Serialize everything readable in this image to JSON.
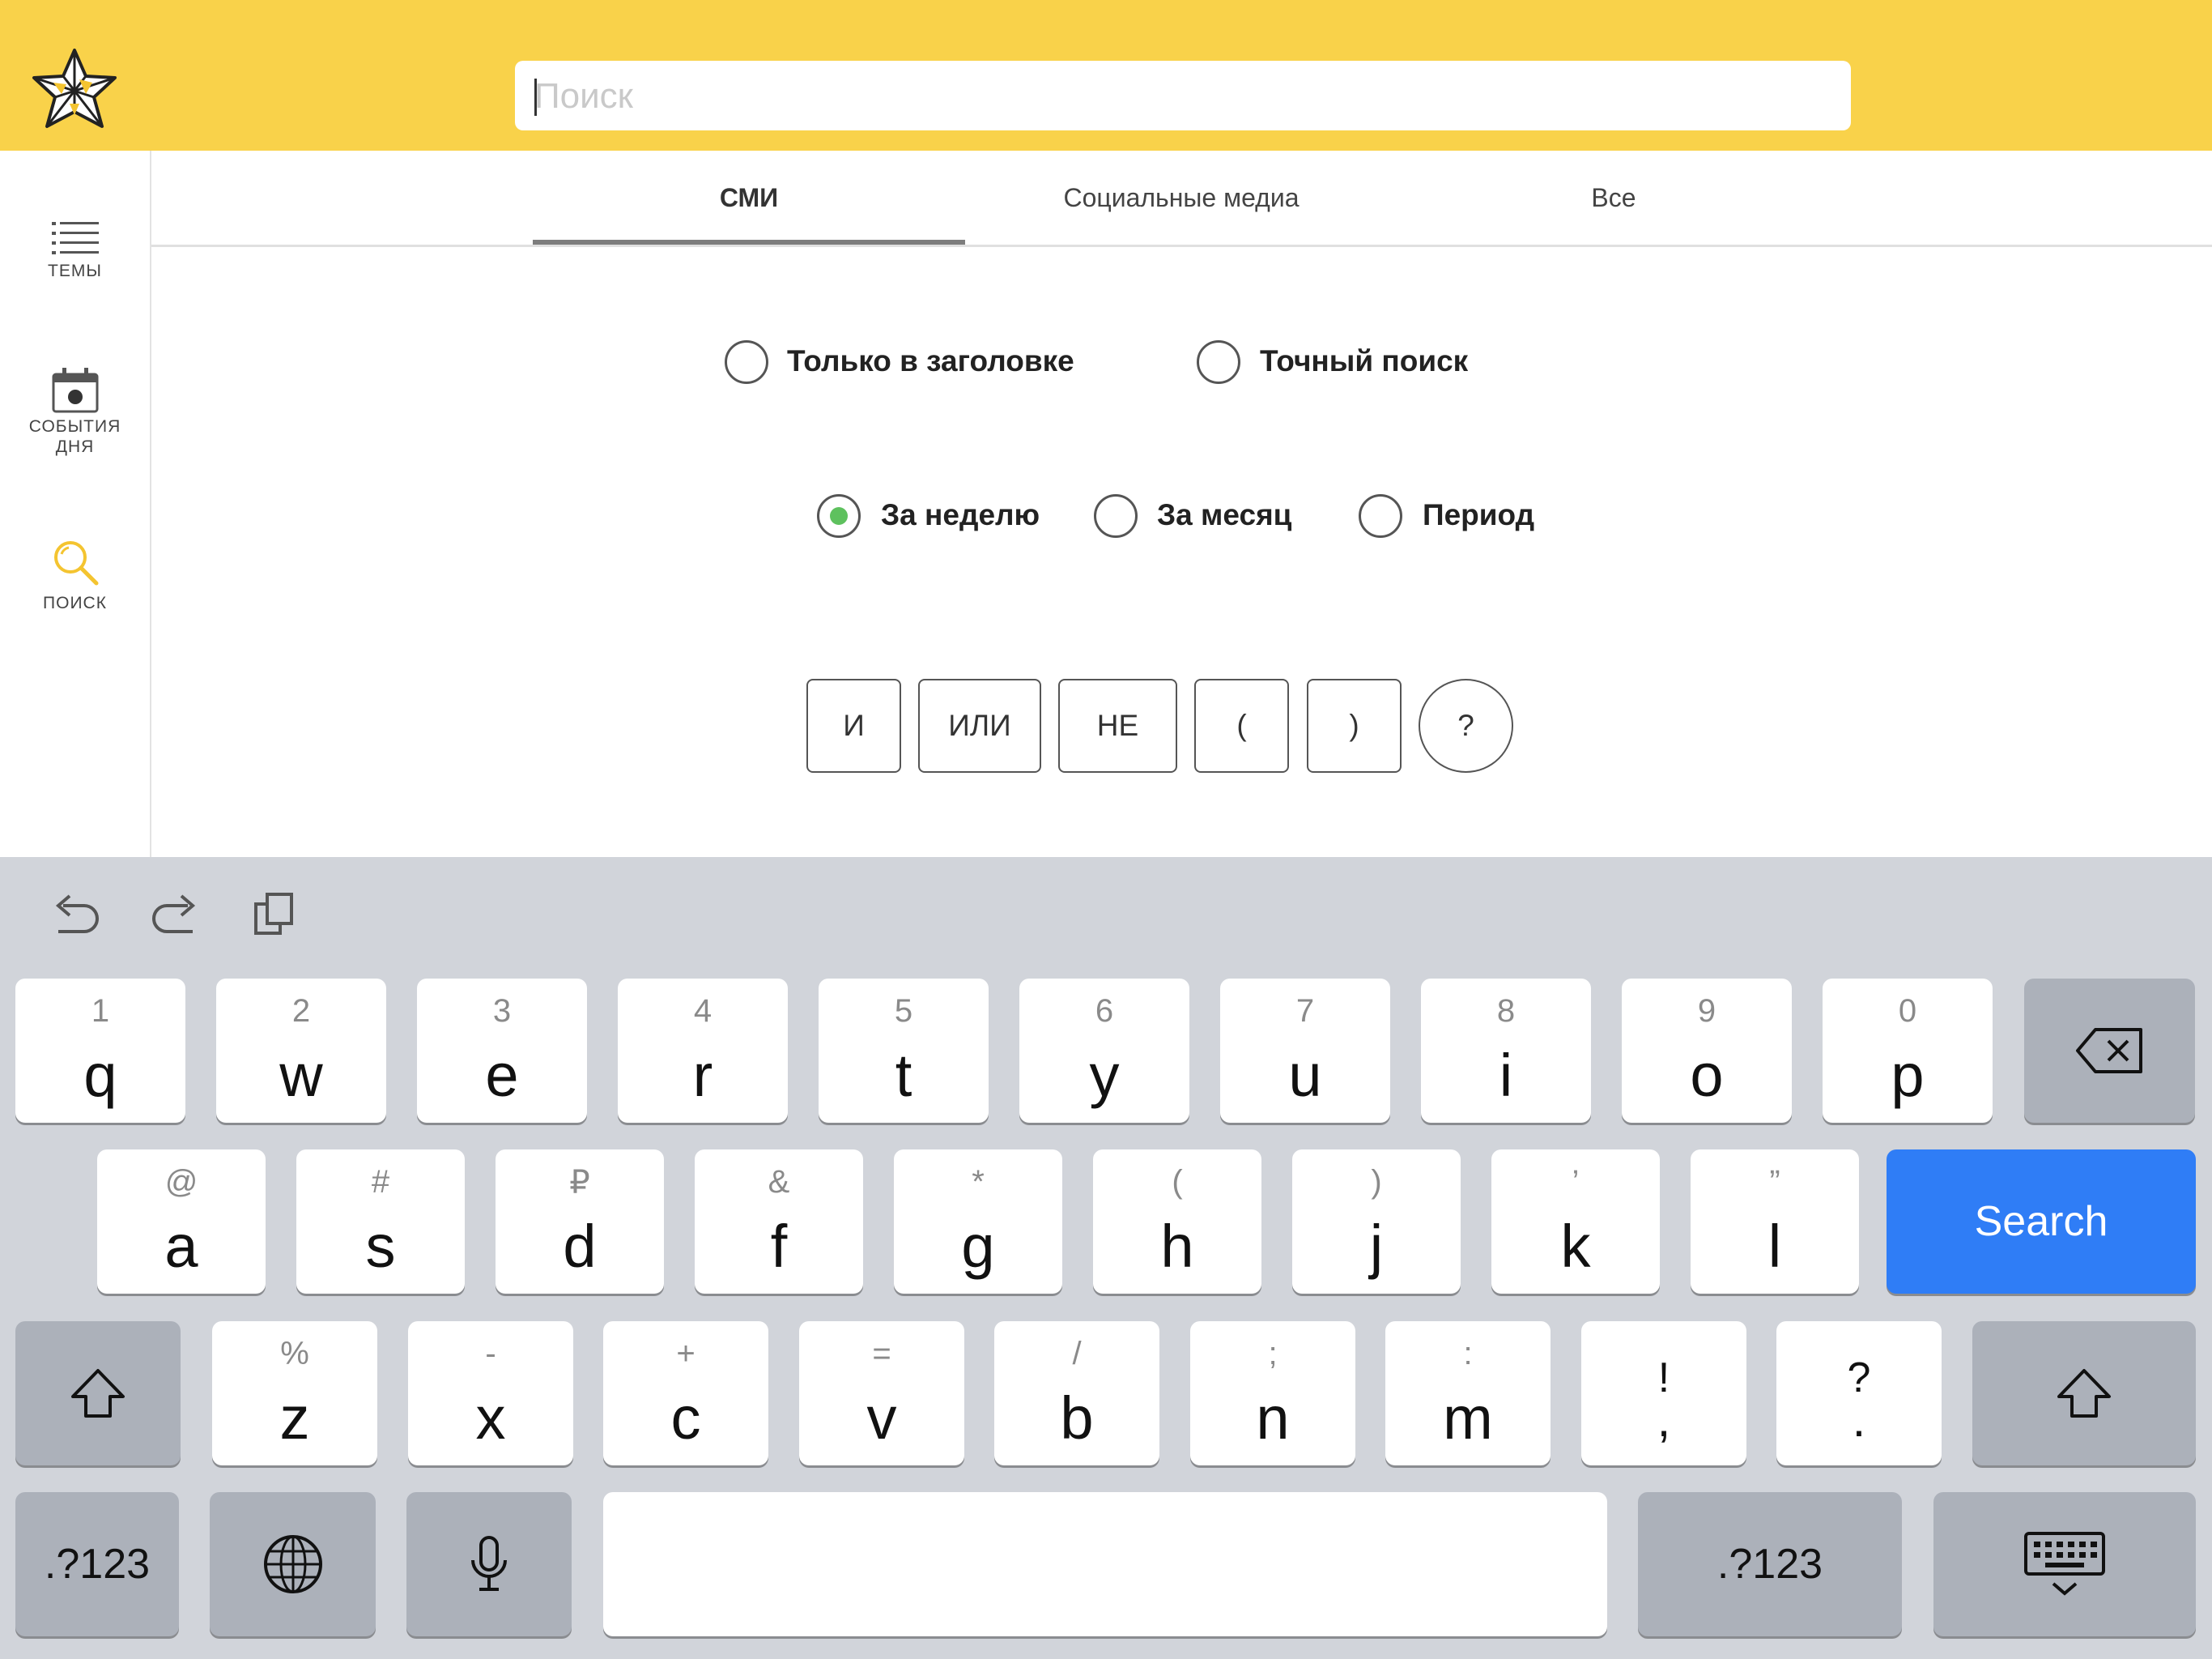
{
  "header": {
    "logo_icon": "folded-star-logo",
    "search_placeholder": "Поиск",
    "search_value": ""
  },
  "sidebar": {
    "items": [
      {
        "id": "topics",
        "label": "ТЕМЫ",
        "icon": "list-icon"
      },
      {
        "id": "events",
        "label_line1": "СОБЫТИЯ",
        "label_line2": "ДНЯ",
        "icon": "calendar-icon"
      },
      {
        "id": "search",
        "label": "ПОИСК",
        "icon": "search-icon",
        "active": true
      }
    ],
    "active_color": "#f4c430"
  },
  "tabs": [
    {
      "label": "СМИ",
      "active": true
    },
    {
      "label": "Социальные медиа",
      "active": false
    },
    {
      "label": "Все",
      "active": false
    }
  ],
  "options": {
    "scope": [
      {
        "label": "Только в заголовке",
        "checked": false
      },
      {
        "label": "Точный поиск",
        "checked": false
      }
    ],
    "period": [
      {
        "label": "За неделю",
        "checked": true
      },
      {
        "label": "За месяц",
        "checked": false
      },
      {
        "label": "Период",
        "checked": false
      }
    ],
    "checked_color": "#5ec15e"
  },
  "operators": [
    "И",
    "ИЛИ",
    "НЕ",
    "(",
    ")",
    "?"
  ],
  "keyboard": {
    "row1": [
      {
        "hint": "1",
        "char": "q"
      },
      {
        "hint": "2",
        "char": "w"
      },
      {
        "hint": "3",
        "char": "e"
      },
      {
        "hint": "4",
        "char": "r"
      },
      {
        "hint": "5",
        "char": "t"
      },
      {
        "hint": "6",
        "char": "y"
      },
      {
        "hint": "7",
        "char": "u"
      },
      {
        "hint": "8",
        "char": "i"
      },
      {
        "hint": "9",
        "char": "o"
      },
      {
        "hint": "0",
        "char": "p"
      }
    ],
    "row2": [
      {
        "hint": "@",
        "char": "a"
      },
      {
        "hint": "#",
        "char": "s"
      },
      {
        "hint": "₽",
        "char": "d"
      },
      {
        "hint": "&",
        "char": "f"
      },
      {
        "hint": "*",
        "char": "g"
      },
      {
        "hint": "(",
        "char": "h"
      },
      {
        "hint": ")",
        "char": "j"
      },
      {
        "hint": "’",
        "char": "k"
      },
      {
        "hint": "”",
        "char": "l"
      }
    ],
    "row3": [
      {
        "hint": "%",
        "char": "z"
      },
      {
        "hint": "-",
        "char": "x"
      },
      {
        "hint": "+",
        "char": "c"
      },
      {
        "hint": "=",
        "char": "v"
      },
      {
        "hint": "/",
        "char": "b"
      },
      {
        "hint": ";",
        "char": "n"
      },
      {
        "hint": ":",
        "char": "m"
      },
      {
        "hint": "!",
        "char": ","
      },
      {
        "hint": "?",
        "char": "."
      }
    ],
    "search_label": "Search",
    "numbers_label": ".?123",
    "accent_color": "#2f7df6"
  }
}
